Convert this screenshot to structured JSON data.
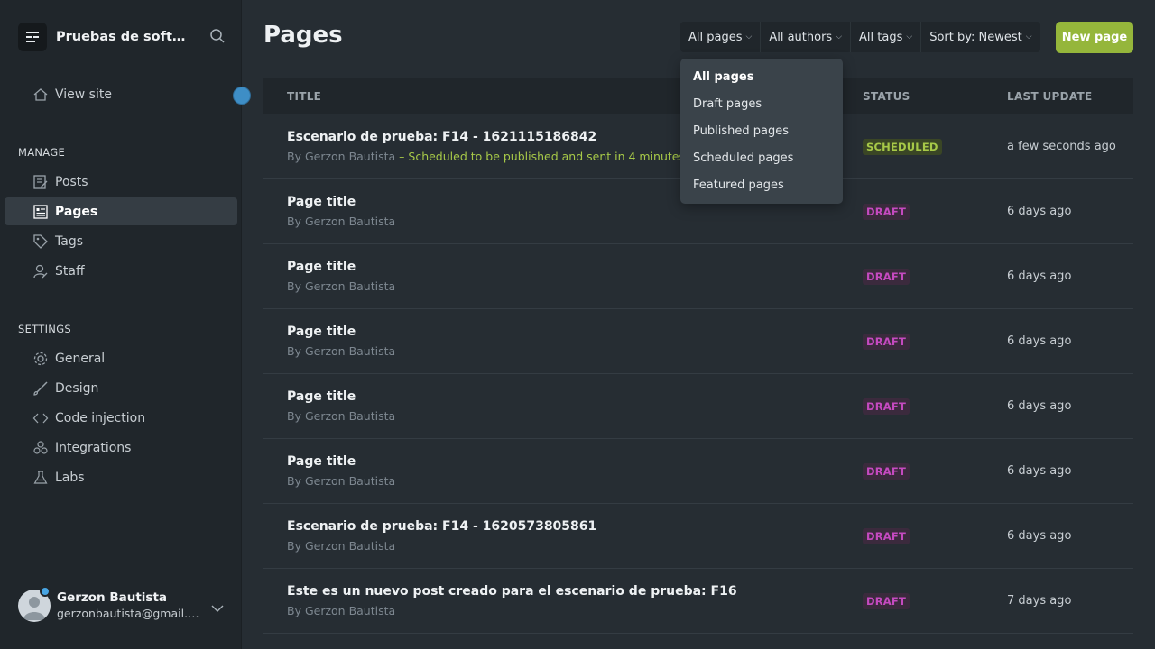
{
  "sidebar": {
    "site_name": "Pruebas de software",
    "view_site": "View site",
    "manage_title": "MANAGE",
    "manage_items": [
      {
        "label": "Posts",
        "icon": "posts-icon"
      },
      {
        "label": "Pages",
        "icon": "pages-icon"
      },
      {
        "label": "Tags",
        "icon": "tag-icon"
      },
      {
        "label": "Staff",
        "icon": "staff-icon"
      }
    ],
    "settings_title": "SETTINGS",
    "settings_items": [
      {
        "label": "General",
        "icon": "gear-icon"
      },
      {
        "label": "Design",
        "icon": "brush-icon"
      },
      {
        "label": "Code injection",
        "icon": "code-icon"
      },
      {
        "label": "Integrations",
        "icon": "integrations-icon"
      },
      {
        "label": "Labs",
        "icon": "flask-icon"
      }
    ],
    "user": {
      "name": "Gerzon Bautista",
      "email": "gerzonbautista@gmail.com"
    }
  },
  "header": {
    "title": "Pages",
    "filters": {
      "type": "All pages",
      "authors": "All authors",
      "tags": "All tags",
      "sort": "Sort by: Newest"
    },
    "new_button": "New page"
  },
  "dropdown": {
    "options": [
      "All pages",
      "Draft pages",
      "Published pages",
      "Scheduled pages",
      "Featured pages"
    ],
    "selected": "All pages"
  },
  "table": {
    "columns": {
      "title": "TITLE",
      "status": "STATUS",
      "updated": "LAST UPDATE"
    },
    "rows": [
      {
        "title": "Escenario de prueba: F14 - 1621115186842",
        "author": "By Gerzon Bautista",
        "note": " – Scheduled to be published and sent in 4 minutes",
        "status": "SCHEDULED",
        "updated": "a few seconds ago"
      },
      {
        "title": "Page title",
        "author": "By Gerzon Bautista",
        "note": "",
        "status": "DRAFT",
        "updated": "6 days ago"
      },
      {
        "title": "Page title",
        "author": "By Gerzon Bautista",
        "note": "",
        "status": "DRAFT",
        "updated": "6 days ago"
      },
      {
        "title": "Page title",
        "author": "By Gerzon Bautista",
        "note": "",
        "status": "DRAFT",
        "updated": "6 days ago"
      },
      {
        "title": "Page title",
        "author": "By Gerzon Bautista",
        "note": "",
        "status": "DRAFT",
        "updated": "6 days ago"
      },
      {
        "title": "Page title",
        "author": "By Gerzon Bautista",
        "note": "",
        "status": "DRAFT",
        "updated": "6 days ago"
      },
      {
        "title": "Escenario de prueba: F14 - 1620573805861",
        "author": "By Gerzon Bautista",
        "note": "",
        "status": "DRAFT",
        "updated": "6 days ago"
      },
      {
        "title": "Este es un nuevo post creado para el escenario de prueba: F16",
        "author": "By Gerzon Bautista",
        "note": "",
        "status": "DRAFT",
        "updated": "7 days ago"
      }
    ]
  },
  "colors": {
    "accent": "#95b63b",
    "draft": "#c54ac0",
    "scheduled": "#a7c948",
    "notification": "#3e8ec6"
  }
}
